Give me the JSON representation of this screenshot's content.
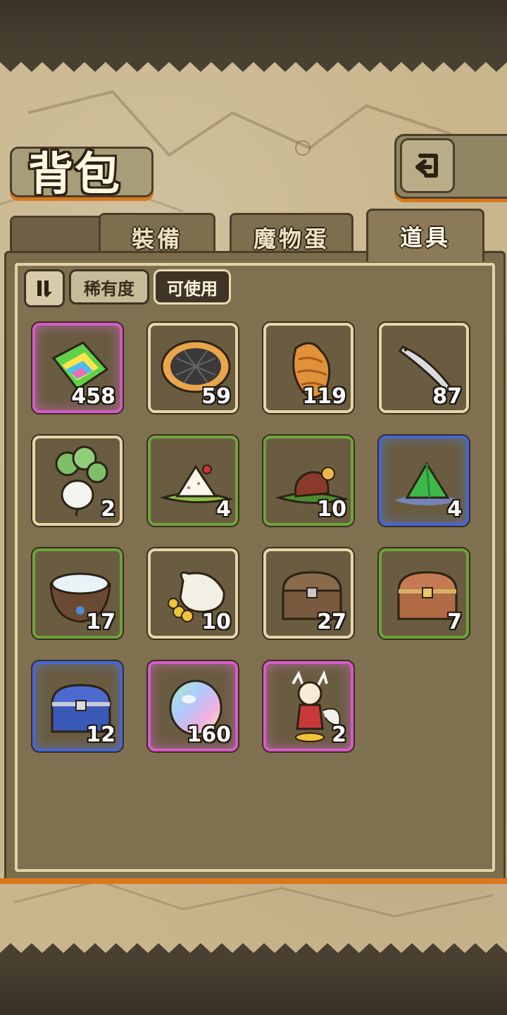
{
  "header": {
    "title": "背包"
  },
  "tabs": [
    {
      "label": "裝備",
      "active": false
    },
    {
      "label": "魔物蛋",
      "active": false
    },
    {
      "label": "道具",
      "active": true
    }
  ],
  "filters": {
    "rarity_label": "稀有度",
    "usable_label": "可使用"
  },
  "items": [
    {
      "name": "rainbow-crystal",
      "count": "458",
      "rarity": "pink"
    },
    {
      "name": "cookie-tart",
      "count": "59",
      "rarity": "common"
    },
    {
      "name": "bread-loaf",
      "count": "119",
      "rarity": "common"
    },
    {
      "name": "fish",
      "count": "87",
      "rarity": "common"
    },
    {
      "name": "turnip",
      "count": "2",
      "rarity": "common"
    },
    {
      "name": "rice-ball",
      "count": "4",
      "rarity": "green"
    },
    {
      "name": "meat-on-leaf",
      "count": "10",
      "rarity": "green"
    },
    {
      "name": "green-jelly",
      "count": "4",
      "rarity": "blue"
    },
    {
      "name": "water-bowl",
      "count": "17",
      "rarity": "green"
    },
    {
      "name": "coin-sack",
      "count": "10",
      "rarity": "common"
    },
    {
      "name": "wooden-chest",
      "count": "27",
      "rarity": "common"
    },
    {
      "name": "bronze-chest",
      "count": "7",
      "rarity": "green"
    },
    {
      "name": "blue-chest",
      "count": "12",
      "rarity": "blue"
    },
    {
      "name": "rainbow-orb",
      "count": "160",
      "rarity": "pink"
    },
    {
      "name": "character-figure",
      "count": "2",
      "rarity": "pink"
    }
  ],
  "colors": {
    "accent_orange": "#d9771e",
    "rarity_pink": "#d75bc9",
    "rarity_green": "#6da33b",
    "rarity_blue": "#4466d8"
  }
}
